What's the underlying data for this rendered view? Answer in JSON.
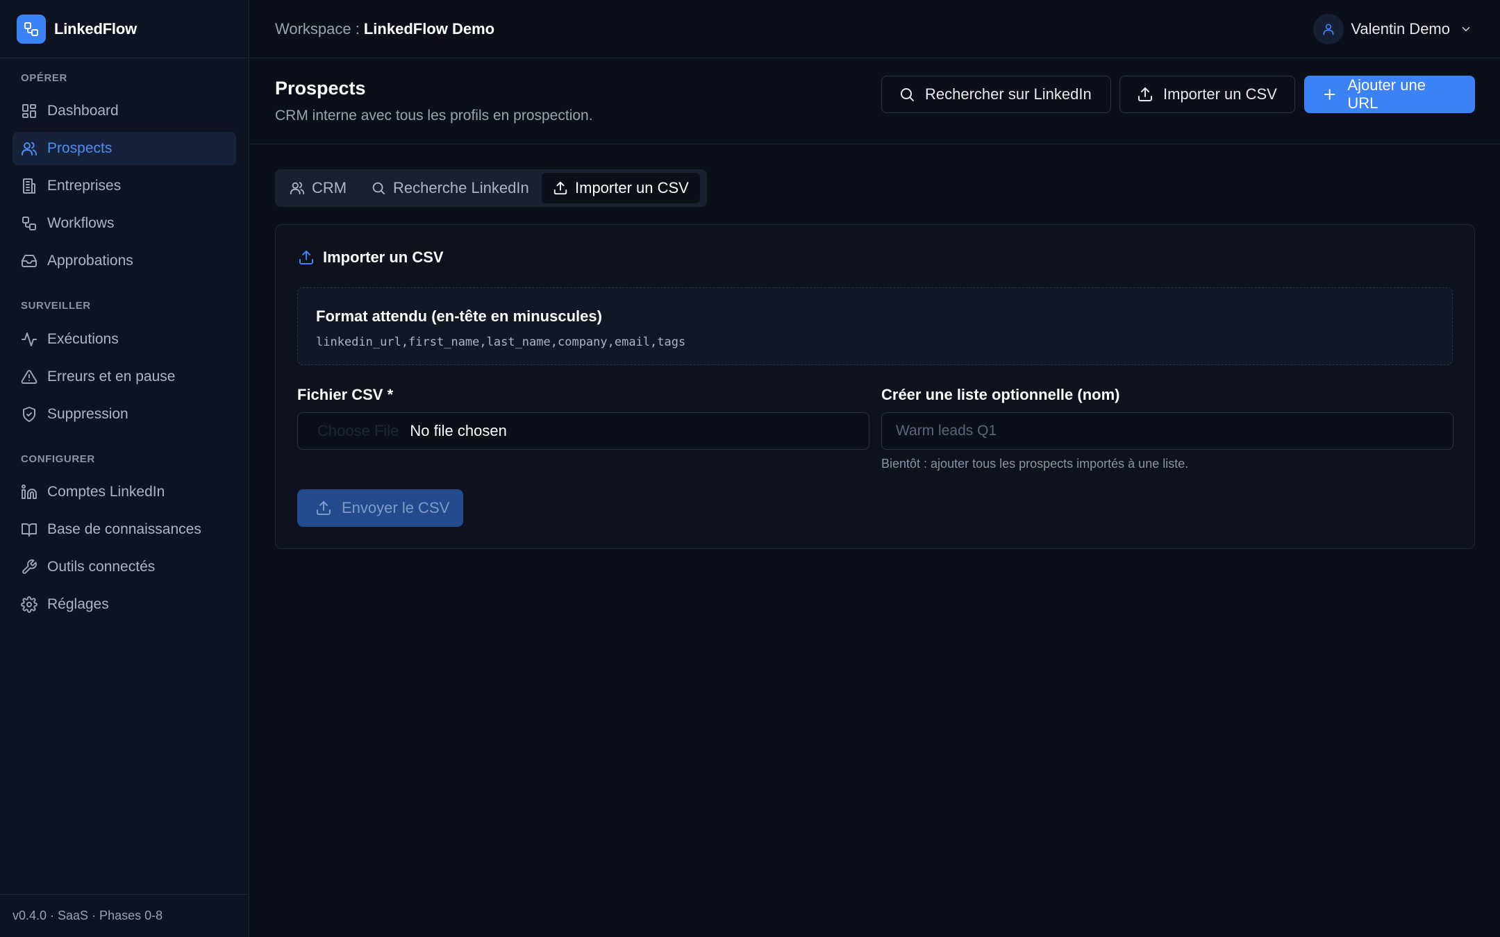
{
  "brand": {
    "name": "LinkedFlow"
  },
  "sidebar": {
    "sections": [
      {
        "title": "OPÉRER"
      },
      {
        "title": "SURVEILLER"
      },
      {
        "title": "CONFIGURER"
      }
    ],
    "items": [
      {
        "label": "Dashboard",
        "icon": "grid-icon"
      },
      {
        "label": "Prospects",
        "icon": "users-icon",
        "active": true
      },
      {
        "label": "Entreprises",
        "icon": "building-icon"
      },
      {
        "label": "Workflows",
        "icon": "workflow-icon"
      },
      {
        "label": "Approbations",
        "icon": "inbox-icon"
      },
      {
        "label": "Exécutions",
        "icon": "activity-icon"
      },
      {
        "label": "Erreurs et en pause",
        "icon": "alert-triangle-icon"
      },
      {
        "label": "Suppression",
        "icon": "shield-icon"
      },
      {
        "label": "Comptes LinkedIn",
        "icon": "linkedin-icon"
      },
      {
        "label": "Base de connaissances",
        "icon": "book-icon"
      },
      {
        "label": "Outils connectés",
        "icon": "wrench-icon"
      },
      {
        "label": "Réglages",
        "icon": "gear-icon"
      }
    ],
    "footer": "v0.4.0 · SaaS · Phases 0-8"
  },
  "topbar": {
    "workspace_label": "Workspace :",
    "workspace_name": "LinkedFlow Demo",
    "user_name": "Valentin Demo"
  },
  "header": {
    "title": "Prospects",
    "subtitle": "CRM interne avec tous les profils en prospection.",
    "buttons": {
      "search_linkedin": "Rechercher sur LinkedIn",
      "import_csv": "Importer un CSV",
      "add_url": "Ajouter une URL"
    }
  },
  "tabs": [
    {
      "label": "CRM",
      "icon": "users-icon"
    },
    {
      "label": "Recherche LinkedIn",
      "icon": "search-icon"
    },
    {
      "label": "Importer un CSV",
      "icon": "upload-icon",
      "active": true
    }
  ],
  "card": {
    "title": "Importer un CSV",
    "format_title": "Format attendu (en-tête en minuscules)",
    "format_code": "linkedin_url,first_name,last_name,company,email,tags",
    "file_label": "Fichier CSV *",
    "file_button": "Choose File",
    "file_status": "No file chosen",
    "list_label": "Créer une liste optionnelle (nom)",
    "list_placeholder": "Warm leads Q1",
    "list_help": "Bientôt : ajouter tous les prospects importés à une liste.",
    "submit_label": "Envoyer le CSV"
  },
  "colors": {
    "accent": "#3b82f6",
    "background": "#0b0f19",
    "sidebar": "#0d1320"
  }
}
